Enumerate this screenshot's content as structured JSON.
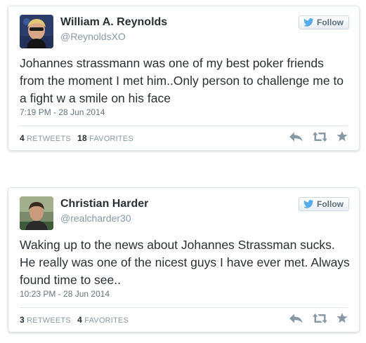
{
  "colors": {
    "text": "#292f33",
    "muted": "#8899a6",
    "meta": "#66757f",
    "twitter_blue": "#55acee",
    "action_icon": "#8899a6"
  },
  "tweets": [
    {
      "author_name": "William A. Reynolds",
      "handle": "@ReynoldsXO",
      "follow_label": "Follow",
      "text": "Johannes strassmann was one of my best poker friends from the moment I met him..Only person to challenge me to a fight w a smile on his face",
      "timestamp": "7:19 PM - 28 Jun 2014",
      "retweets_count": "4",
      "retweets_label": "RETWEETS",
      "favorites_count": "18",
      "favorites_label": "FAVORITES",
      "icons": [
        "reply-icon",
        "retweet-icon",
        "favorite-star-icon"
      ]
    },
    {
      "author_name": "Christian Harder",
      "handle": "@realcharder30",
      "follow_label": "Follow",
      "text": "Waking up to the news about Johannes Strassman sucks. He really was one of the nicest guys I have ever met. Always found time to see..",
      "timestamp": "10:23 PM - 28 Jun 2014",
      "retweets_count": "3",
      "retweets_label": "RETWEETS",
      "favorites_count": "4",
      "favorites_label": "FAVORITES",
      "icons": [
        "reply-icon",
        "retweet-icon",
        "favorite-star-icon"
      ]
    }
  ]
}
